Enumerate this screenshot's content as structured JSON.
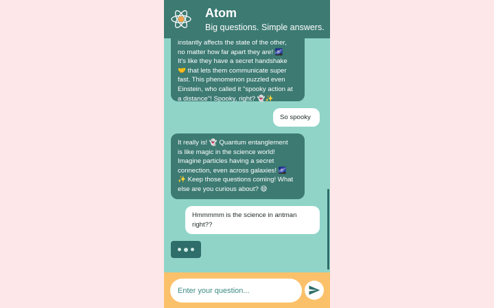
{
  "app": {
    "title": "Atom",
    "tagline": "Big questions. Simple answers."
  },
  "messages": [
    {
      "role": "bot",
      "text": "instantly affects the state of the other,\nno matter how far apart they are! 🌌\nIt's like they have a secret handshake\n🤝 that lets them communicate super\nfast. This phenomenon puzzled even\nEinstein, who called it \"spooky action at\na distance\"! Spooky, right? 👻✨"
    },
    {
      "role": "user",
      "text": "So spooky"
    },
    {
      "role": "bot",
      "text": "It really is! 👻 Quantum entanglement\nis like magic in the science world!\nImagine particles having a secret\nconnection, even across galaxies! 🌌\n✨ Keep those questions coming! What\nelse are you curious about? 😄"
    },
    {
      "role": "user",
      "text": "Hmmmmm is the science in antman\nright??"
    }
  ],
  "composer": {
    "placeholder": "Enter your question...",
    "value": ""
  },
  "icons": {
    "logo": "atom-icon",
    "send": "send-icon",
    "typing": "typing-indicator"
  },
  "colors": {
    "header": "#3c7a72",
    "chat_background": "#90d4c8",
    "bot_bubble": "#3c7a72",
    "user_bubble": "#ffffff",
    "composer_bar": "#fbc16a",
    "page_background": "#fde7e9"
  }
}
